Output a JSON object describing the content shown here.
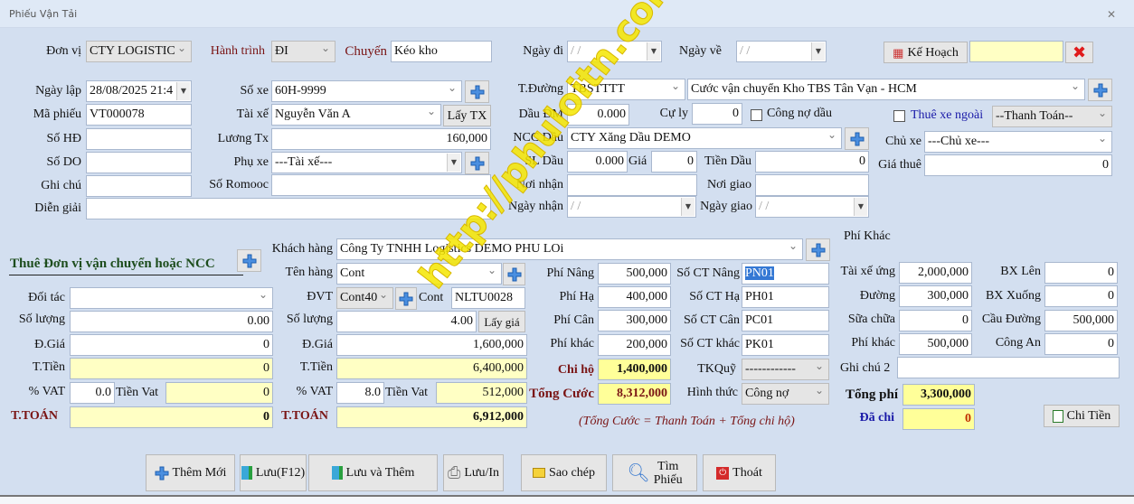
{
  "window": {
    "title": "Phiếu Vận Tải",
    "close_icon": "close-icon"
  },
  "watermark": "http://phuloitn.com",
  "header": {
    "don_vi_label": "Đơn vị",
    "don_vi": "CTY LOGISTIC",
    "hanh_trinh_label": "Hành trình",
    "hanh_trinh": "ĐI",
    "chuyen_label": "Chuyến",
    "chuyen": "Kéo kho",
    "ngay_di_label": "Ngày đi",
    "ngay_di": " /  /",
    "ngay_ve_label": "Ngày về",
    "ngay_ve": " /  /",
    "ke_hoach_label": "Kế Hoạch",
    "ke_hoach_value": ""
  },
  "info": {
    "ngay_lap_label": "Ngày lập",
    "ngay_lap": "28/08/2025  21:4",
    "ma_phieu_label": "Mã phiếu",
    "ma_phieu": "VT000078",
    "so_hd_label": "Số HĐ",
    "so_hd": "",
    "so_do_label": "Số DO",
    "so_do": "",
    "ghi_chu_label": "Ghi chú",
    "ghi_chu": "",
    "dien_giai_label": "Diễn giải",
    "dien_giai": ""
  },
  "vehicle": {
    "so_xe_label": "Số xe",
    "so_xe": "60H-9999",
    "tai_xe_label": "Tài xế",
    "tai_xe": "Nguyễn Văn A",
    "lay_tx": "Lấy TX",
    "luong_tx_label": "Lương Tx",
    "luong_tx": "160,000",
    "phu_xe_label": "Phụ xe",
    "phu_xe": "---Tài xế---",
    "so_romooc_label": "Số Romooc",
    "so_romooc": ""
  },
  "route": {
    "t_duong_label": "T.Đường",
    "t_duong": "TBSTTTT",
    "route_desc": "Cước vận chuyển Kho TBS Tân Vạn - HCM",
    "dau_dm_label": "Dầu ĐM",
    "dau_dm": "0.000",
    "cu_ly_label": "Cự ly",
    "cu_ly": "0",
    "cong_no_dau": "Công nợ dầu",
    "ncc_dau_label": "NCC Dầu",
    "ncc_dau": "CTY Xăng Dầu DEMO",
    "sl_dau_label": "SL Dầu",
    "sl_dau": "0.000",
    "gia_label": "Giá",
    "gia": "0",
    "tien_dau_label": "Tiền Dầu",
    "tien_dau": "0",
    "noi_nhan_label": "Nơi nhận",
    "noi_nhan": "",
    "noi_giao_label": "Nơi giao",
    "noi_giao": "",
    "ngay_nhan_label": "Ngày nhận",
    "ngay_nhan": " /  /",
    "ngay_giao_label": "Ngày giao",
    "ngay_giao": " /  /"
  },
  "rent": {
    "thue_xe_ngoai": "Thuê xe ngoài",
    "thanh_toan": "--Thanh Toán--",
    "chu_xe_label": "Chủ xe",
    "chu_xe": "---Chủ xe---",
    "gia_thue_label": "Giá thuê",
    "gia_thue": "0"
  },
  "ncc": {
    "title": "Thuê Đơn vị vận chuyển hoặc NCC",
    "doi_tac_label": "Đối tác",
    "doi_tac": "",
    "so_luong_label": "Số lượng",
    "so_luong": "0.00",
    "don_gia_label": "Đ.Giá",
    "don_gia": "0",
    "t_tien_label": "T.Tiền",
    "t_tien": "0",
    "vat_label": "% VAT",
    "vat": "0.0",
    "tien_vat_label": "Tiền Vat",
    "tien_vat": "0",
    "t_toan_label": "T.TOÁN",
    "t_toan": "0"
  },
  "customer": {
    "khach_hang_label": "Khách hàng",
    "khach_hang": "Công Ty  TNHH Logistics DEMO PHU LOi",
    "ten_hang_label": "Tên hàng",
    "ten_hang": "Cont",
    "dvt_label": "ĐVT",
    "dvt": "Cont40",
    "cont_label": "Cont",
    "cont": "NLTU0028",
    "so_luong_label": "Số lượng",
    "so_luong": "4.00",
    "lay_gia": "Lấy giá",
    "don_gia_label": "Đ.Giá",
    "don_gia": "1,600,000",
    "t_tien_label": "T.Tiền",
    "t_tien": "6,400,000",
    "vat_label": "% VAT",
    "vat": "8.0",
    "tien_vat_label": "Tiền Vat",
    "tien_vat": "512,000",
    "t_toan_label": "T.TOÁN",
    "t_toan": "6,912,000"
  },
  "fees": {
    "rows": [
      {
        "label": "Phí Nâng",
        "value": "500,000",
        "ct_label": "Số CT Nâng",
        "ct": "PN01"
      },
      {
        "label": "Phí Hạ",
        "value": "400,000",
        "ct_label": "Số CT Hạ",
        "ct": "PH01"
      },
      {
        "label": "Phí Cân",
        "value": "300,000",
        "ct_label": "Số CT Cân",
        "ct": "PC01"
      },
      {
        "label": "Phí khác",
        "value": "200,000",
        "ct_label": "Số CT khác",
        "ct": "PK01"
      }
    ],
    "chi_ho_label": "Chi hộ",
    "chi_ho": "1,400,000",
    "tk_quy_label": "TKQuỹ",
    "tk_quy": "------------",
    "tong_cuoc_label": "Tổng Cước",
    "tong_cuoc": "8,312,000",
    "hinh_thuc_label": "Hình thức",
    "hinh_thuc": "Công nợ",
    "formula": "(Tổng Cước = Thanh Toán + Tổng chi hộ)"
  },
  "other_fees": {
    "title": "Phí Khác",
    "left": [
      {
        "label": "Tài xế ứng",
        "value": "2,000,000"
      },
      {
        "label": "Đường",
        "value": "300,000"
      },
      {
        "label": "Sữa chữa",
        "value": "0"
      },
      {
        "label": "Phí khác",
        "value": "500,000"
      }
    ],
    "right": [
      {
        "label": "BX Lên",
        "value": "0"
      },
      {
        "label": "BX Xuống",
        "value": "0"
      },
      {
        "label": "Cầu Đường",
        "value": "500,000"
      },
      {
        "label": "Công An",
        "value": "0"
      }
    ],
    "ghi_chu_2_label": "Ghi chú 2",
    "ghi_chu_2": "",
    "tong_phi_label": "Tổng phí",
    "tong_phi": "3,300,000",
    "da_chi_label": "Đã chi",
    "da_chi": "0",
    "chi_tien": "Chi Tiền"
  },
  "toolbar": {
    "them_moi": "Thêm Mới",
    "luu": "Lưu(F12)",
    "luu_va_them": "Lưu và Thêm",
    "luu_in": "Lưu/In",
    "sao_chep": "Sao chép",
    "tim_phieu_1": "Tìm",
    "tim_phieu_2": "Phiếu",
    "thoat": "Thoát"
  },
  "colors": {
    "background": "#d3dff0",
    "label_red": "#7a1515",
    "highlight_yellow": "#ffff99",
    "blue_label": "#1a1aa8",
    "green_title": "#1d4d1d"
  }
}
